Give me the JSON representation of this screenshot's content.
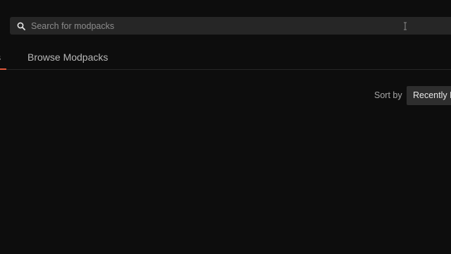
{
  "search": {
    "placeholder": "Search for modpacks",
    "value": ""
  },
  "tabs": [
    {
      "label": "My Modpacks",
      "visible_text": "cks",
      "active": true
    },
    {
      "label": "Browse Modpacks",
      "visible_text": "Browse Modpacks",
      "active": false
    }
  ],
  "sort": {
    "label": "Sort by",
    "selected": "Recently P"
  },
  "colors": {
    "background": "#0d0d0d",
    "search_bg": "#262626",
    "accent": "#e2593b",
    "select_bg": "#2e2e2e"
  },
  "icons": {
    "search": "search-icon",
    "cursor": "text-cursor-icon"
  }
}
